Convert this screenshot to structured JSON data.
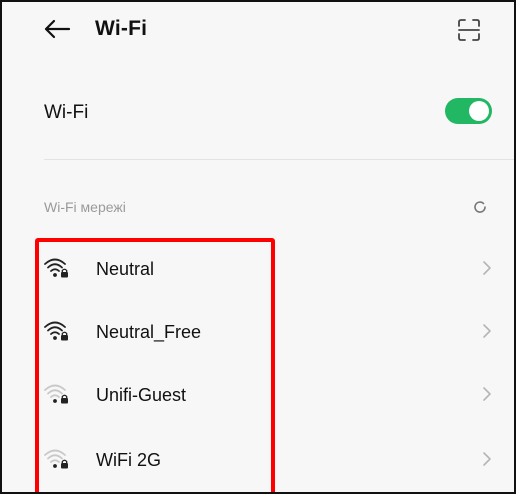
{
  "header": {
    "title": "Wi-Fi",
    "back_icon": "back-arrow-icon",
    "scan_icon": "qr-scan-icon"
  },
  "wifi_toggle": {
    "label": "Wi-Fi",
    "state": "on",
    "accent_color": "#21b763"
  },
  "networks": {
    "section_label": "Wi-Fi мережі",
    "refresh_icon": "refresh-spinner-icon",
    "highlight_color": "#ff0000",
    "items": [
      {
        "name": "Neutral",
        "signal": "strong",
        "secured": true
      },
      {
        "name": "Neutral_Free",
        "signal": "strong",
        "secured": true
      },
      {
        "name": "Unifi-Guest",
        "signal": "weak",
        "secured": true
      },
      {
        "name": "WiFi 2G",
        "signal": "weak",
        "secured": true
      }
    ]
  }
}
